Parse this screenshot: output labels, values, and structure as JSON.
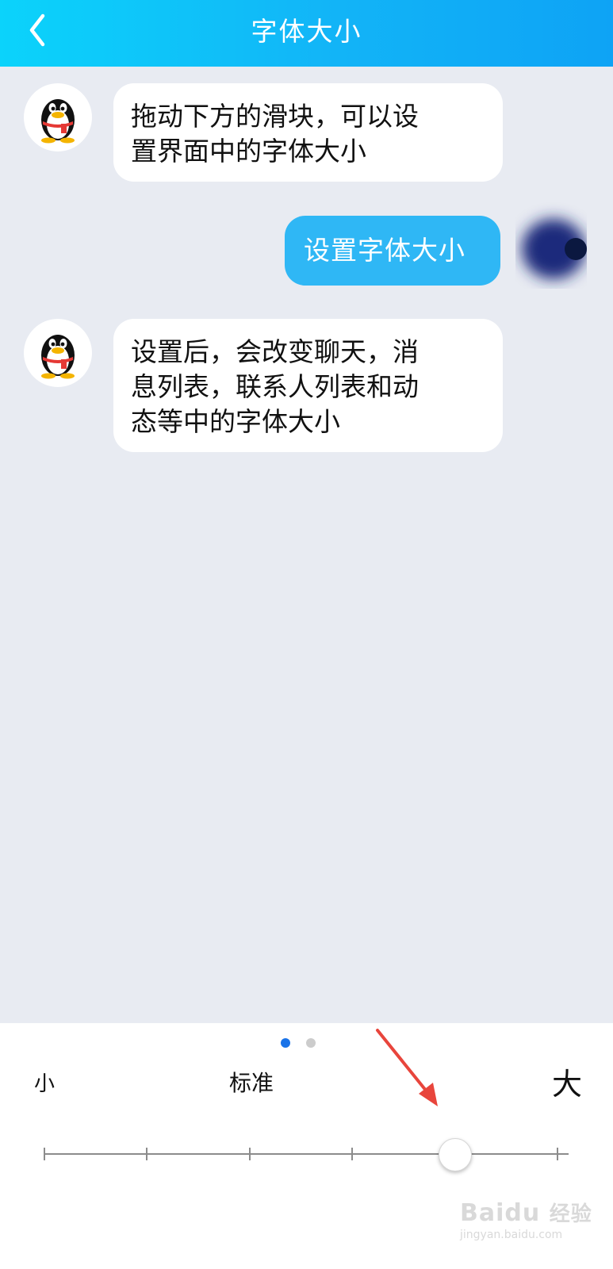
{
  "header": {
    "title": "字体大小",
    "back_icon": "chevron-left-icon"
  },
  "colors": {
    "header_start": "#0bd3fb",
    "header_end": "#0ea3f5",
    "chat_background": "#e8ebf2",
    "incoming_bubble": "#ffffff",
    "outgoing_bubble": "#2fb7f5",
    "page_dot_active": "#1a73e8",
    "page_dot_inactive": "#cccccc",
    "annotation_arrow": "#e8453c"
  },
  "messages": [
    {
      "side": "incoming",
      "avatar_icon": "qq-penguin-icon",
      "lines": [
        "拖动下方的滑块，可以设",
        "置界面中的字体大小"
      ]
    },
    {
      "side": "outgoing",
      "avatar_icon": "blurred-user-avatar",
      "lines": [
        "设置字体大小"
      ]
    },
    {
      "side": "incoming",
      "avatar_icon": "qq-penguin-icon",
      "lines": [
        "设置后，会改变聊天，消",
        "息列表，联系人列表和动",
        "态等中的字体大小"
      ]
    }
  ],
  "pager": {
    "total": 2,
    "active_index": 0
  },
  "font_scale": {
    "small_label": "小",
    "standard_label": "标准",
    "large_label": "大",
    "steps": 6,
    "selected_step": 4
  },
  "watermark": {
    "brand": "Baidu",
    "brand_cn": "经验",
    "url": "jingyan.baidu.com"
  }
}
